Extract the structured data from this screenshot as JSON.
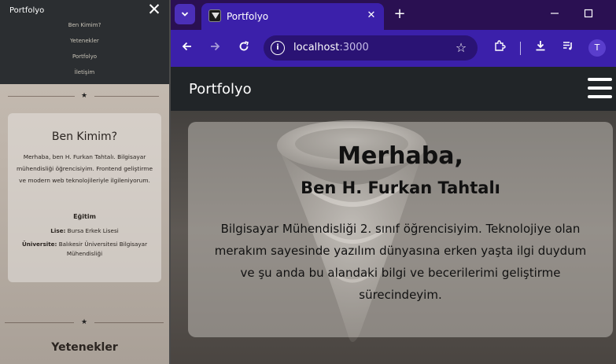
{
  "mobile": {
    "brand": "Portfolyo",
    "nav_links": [
      "Ben Kimim?",
      "Yetenekler",
      "Portfolyo",
      "İletişim"
    ],
    "about": {
      "title": "Ben Kimim?",
      "text": "Merhaba, ben H. Furkan Tahtalı. Bilgisayar mühendisliği öğrencisiyim. Frontend geliştirme ve modern web teknolojileriyle ilgileniyorum.",
      "education_title": "Eğitim",
      "lise_label": "Lise:",
      "lise_value": "Bursa Erkek Lisesi",
      "uni_label": "Üniversite:",
      "uni_value": "Balıkesir Üniversitesi Bilgisayar Mühendisliği"
    },
    "skills_title": "Yetenekler"
  },
  "browser": {
    "tab_title": "Portfolyo",
    "url_host": "localhost",
    "url_port": ":3000",
    "profile_initial": "T"
  },
  "page": {
    "brand": "Portfolyo",
    "hero": {
      "heading": "Merhaba,",
      "subheading": "Ben H. Furkan Tahtalı",
      "paragraph": "Bilgisayar Mühendisliği 2. sınıf öğrencisiyim. Teknolojiye olan merakım sayesinde yazılım dünyasına erken yaşta ilgi duydum ve şu anda bu alandaki bilgi ve becerilerimi geliştirme sürecindeyim."
    }
  },
  "colors": {
    "tab_strip": "#2a1052",
    "toolbar": "#3b20aa",
    "omnibox": "#2a1374",
    "page_nav": "#212528",
    "mobile_nav": "#2b2e31"
  }
}
